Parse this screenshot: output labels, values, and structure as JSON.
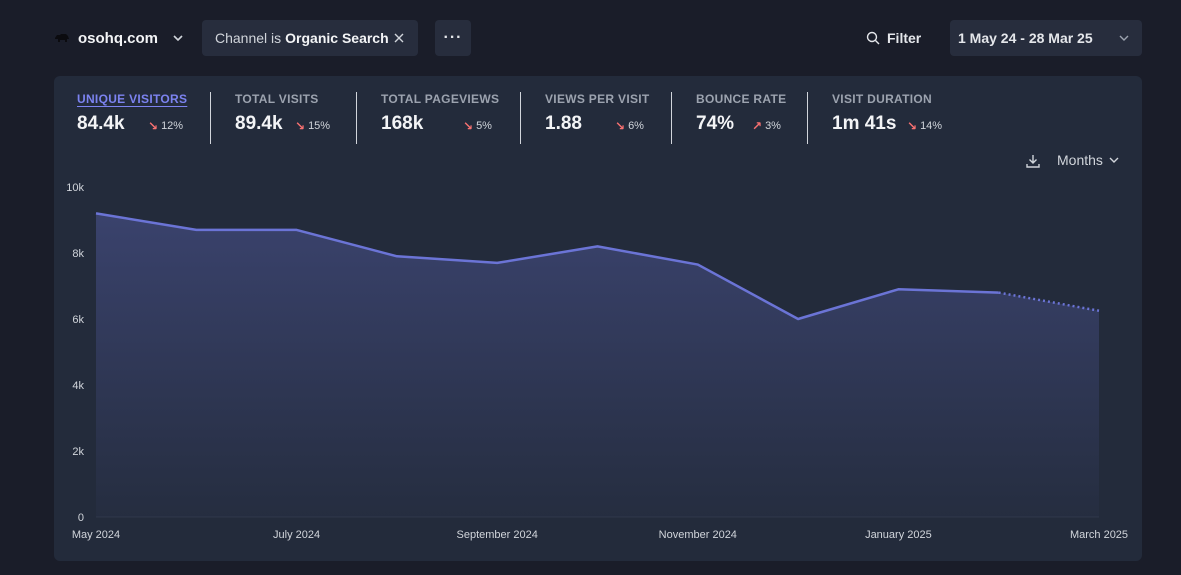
{
  "site": {
    "name": "osohq.com",
    "logo_icon": "bear-logo"
  },
  "filter_chip": {
    "prefix": "Channel is",
    "value": "Organic Search"
  },
  "more_button": {
    "label": "···"
  },
  "filter_button": {
    "label": "Filter"
  },
  "date_range": {
    "label": "1 May 24 - 28 Mar 25"
  },
  "stats": [
    {
      "label": "UNIQUE VISITORS",
      "value": "84.4k",
      "change": "12%",
      "direction": "down",
      "active": true
    },
    {
      "label": "TOTAL VISITS",
      "value": "89.4k",
      "change": "15%",
      "direction": "down"
    },
    {
      "label": "TOTAL PAGEVIEWS",
      "value": "168k",
      "change": "5%",
      "direction": "down"
    },
    {
      "label": "VIEWS PER VISIT",
      "value": "1.88",
      "change": "6%",
      "direction": "down"
    },
    {
      "label": "BOUNCE RATE",
      "value": "74%",
      "change": "3%",
      "direction": "up"
    },
    {
      "label": "VISIT DURATION",
      "value": "1m 41s",
      "change": "14%",
      "direction": "down"
    }
  ],
  "interval": {
    "label": "Months"
  },
  "colors": {
    "accent": "#6b74d6",
    "background": "#1a1d29",
    "panel": "#232b3b",
    "negative": "#f87171"
  },
  "chart_data": {
    "type": "area",
    "x": [
      "May 2024",
      "Jun 2024",
      "Jul 2024",
      "Aug 2024",
      "Sep 2024",
      "Oct 2024",
      "Nov 2024",
      "Dec 2024",
      "Jan 2025",
      "Feb 2025",
      "Mar 2025"
    ],
    "values": [
      9200,
      8700,
      8700,
      7900,
      7700,
      8200,
      7650,
      6000,
      6900,
      6800,
      6250
    ],
    "partial_last_point": true,
    "x_tick_labels": [
      "May 2024",
      "July 2024",
      "September 2024",
      "November 2024",
      "January 2025",
      "March 2025"
    ],
    "y_tick_labels": [
      "0",
      "2k",
      "4k",
      "6k",
      "8k",
      "10k"
    ],
    "ylim": [
      0,
      10000
    ],
    "grid": false
  }
}
